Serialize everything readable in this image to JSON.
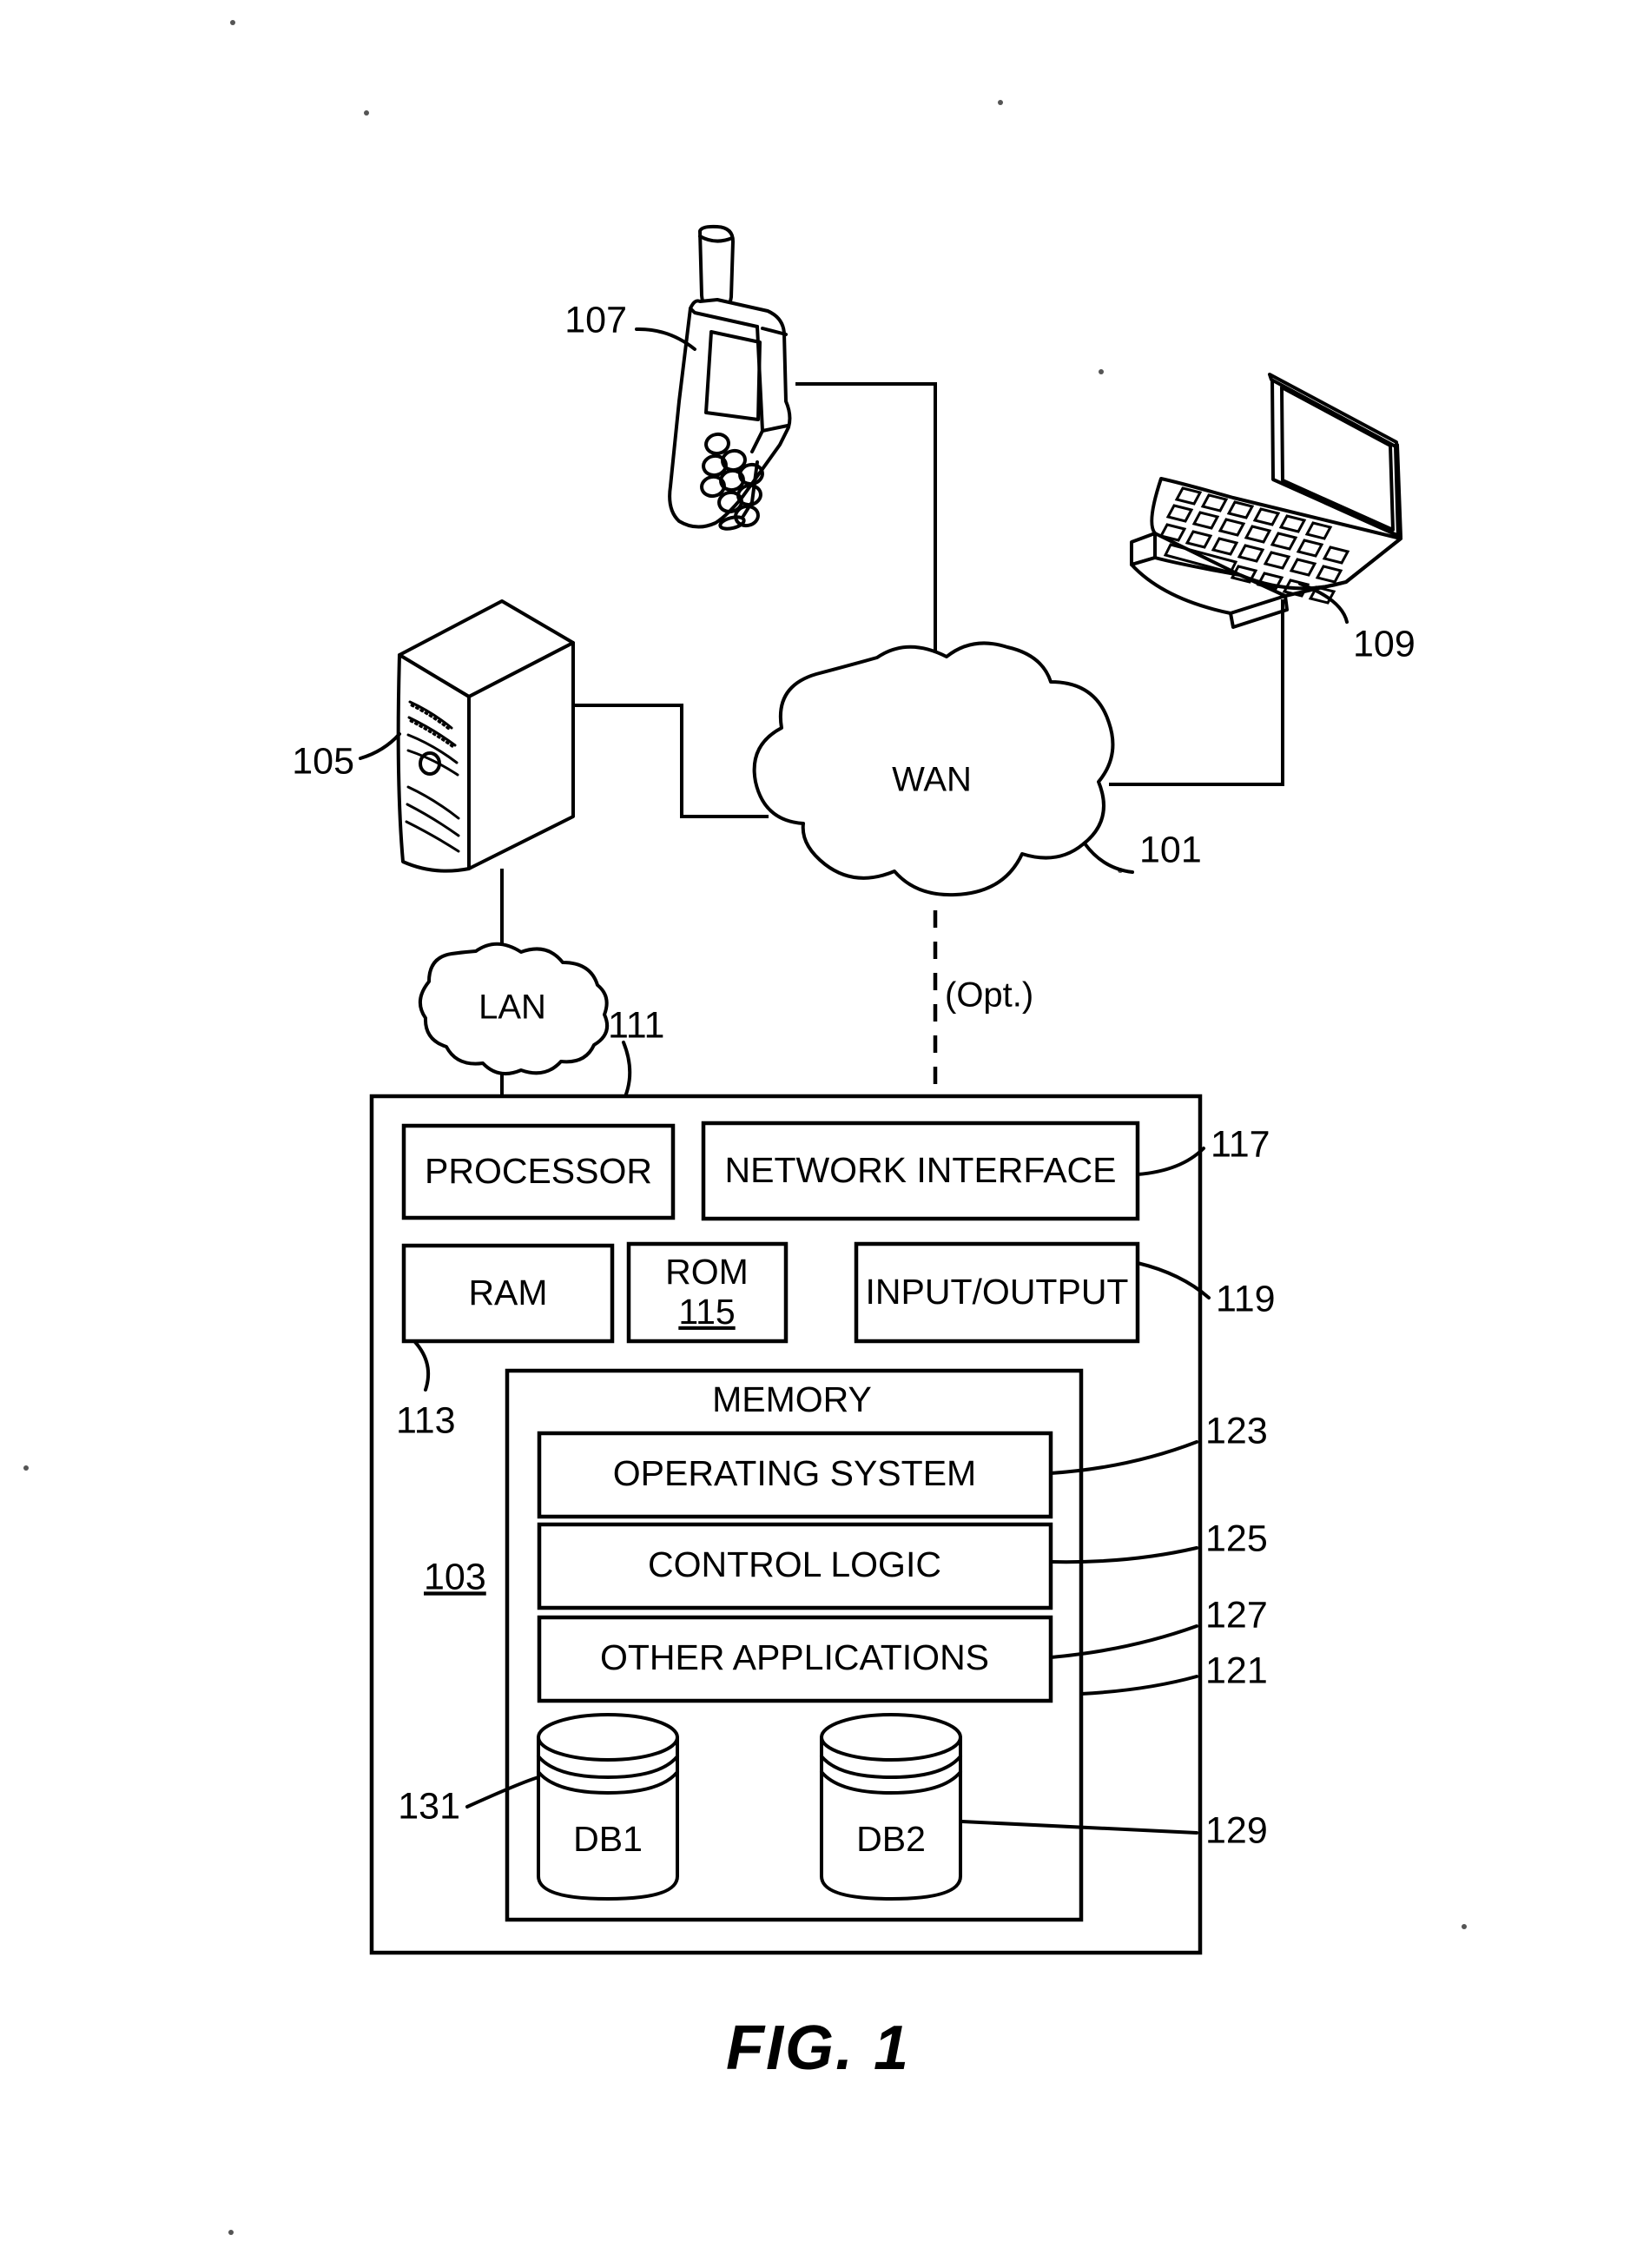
{
  "figure": {
    "caption": "FIG. 1",
    "type": "patent-network-architecture-diagram"
  },
  "network_nodes": {
    "wan": {
      "label": "WAN",
      "ref": "101"
    },
    "lan": {
      "label": "LAN",
      "ref": "111"
    },
    "optional_link": {
      "label": "(Opt.)"
    }
  },
  "devices": {
    "server": {
      "name": "server-tower",
      "ref": "105"
    },
    "mobile_phone": {
      "name": "mobile-phone",
      "ref": "107"
    },
    "laptop": {
      "name": "laptop-computer",
      "ref": "109"
    }
  },
  "computing_device": {
    "ref": "103",
    "components": [
      {
        "label": "PROCESSOR",
        "ref": "111"
      },
      {
        "label": "NETWORK INTERFACE",
        "ref": "117"
      },
      {
        "label": "RAM",
        "ref": "113"
      },
      {
        "label": "ROM",
        "ref": "115"
      },
      {
        "label": "INPUT/OUTPUT",
        "ref": "119"
      }
    ],
    "memory": {
      "label": "MEMORY",
      "ref": "121",
      "modules": [
        {
          "label": "OPERATING SYSTEM",
          "ref": "123"
        },
        {
          "label": "CONTROL LOGIC",
          "ref": "125"
        },
        {
          "label": "OTHER APPLICATIONS",
          "ref": "127"
        }
      ],
      "databases": [
        {
          "label": "DB1",
          "ref": "131"
        },
        {
          "label": "DB2",
          "ref": "129"
        }
      ]
    }
  },
  "reference_numerals": {
    "n101": "101",
    "n103": "103",
    "n105": "105",
    "n107": "107",
    "n109": "109",
    "n111": "111",
    "n113": "113",
    "n115": "115",
    "n117": "117",
    "n119": "119",
    "n121": "121",
    "n123": "123",
    "n125": "125",
    "n127": "127",
    "n129": "129",
    "n131": "131"
  },
  "colors": {
    "ink": "#000000",
    "paper": "#ffffff"
  }
}
